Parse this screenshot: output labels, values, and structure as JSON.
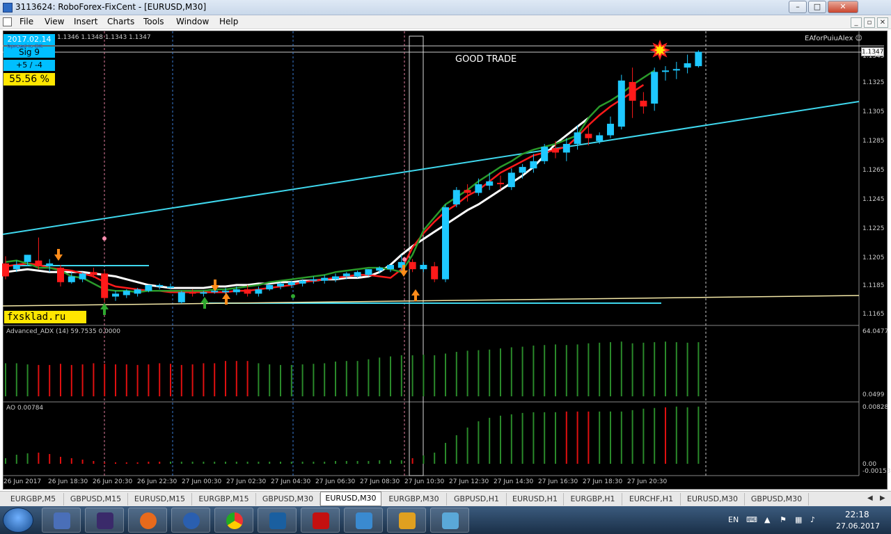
{
  "window": {
    "title": "3113624: RoboForex-FixCent - [EURUSD,M30]",
    "min": "–",
    "max": "□",
    "close": "✕"
  },
  "menu": [
    "File",
    "View",
    "Insert",
    "Charts",
    "Tools",
    "Window",
    "Help"
  ],
  "mdi_controls": [
    "_",
    "▫",
    "✕"
  ],
  "info_panel": {
    "date": "2017.02.14",
    "spread_note": "Spread is OK",
    "signal": "Sig  9",
    "plus_minus": "+5 / -4",
    "percent": "55.56 %"
  },
  "ohlc": "1.1346 1.1348 1.1343 1.1347",
  "ea_label": "EAforPuiuAlex ☺",
  "annotation": "GOOD TRADE",
  "brand": "fxsklad.ru",
  "price_axis": [
    "1.1345",
    "1.1325",
    "1.1305",
    "1.1285",
    "1.1265",
    "1.1245",
    "1.1225",
    "1.1205",
    "1.1185",
    "1.1165"
  ],
  "current_price": "1.1347",
  "adx": {
    "label": "Advanced_ADX (14) 59.7535 0.0000",
    "max": "64.0477",
    "min": "0.0499"
  },
  "ao": {
    "label": "AO 0.00784",
    "max": "0.00828",
    "zero": "0.00",
    "min": "-0.00153"
  },
  "time_axis": [
    "26 Jun 2017",
    "26 Jun 18:30",
    "26 Jun 20:30",
    "26 Jun 22:30",
    "27 Jun 00:30",
    "27 Jun 02:30",
    "27 Jun 04:30",
    "27 Jun 06:30",
    "27 Jun 08:30",
    "27 Jun 10:30",
    "27 Jun 12:30",
    "27 Jun 14:30",
    "27 Jun 16:30",
    "27 Jun 18:30",
    "27 Jun 20:30"
  ],
  "tabs": [
    "EURGBP,M5",
    "GBPUSD,M15",
    "EURUSD,M15",
    "EURGBP,M15",
    "GBPUSD,M30",
    "EURUSD,M30",
    "EURGBP,M30",
    "GBPUSD,H1",
    "EURUSD,H1",
    "EURGBP,H1",
    "EURCHF,H1",
    "EURUSD,M30",
    "GBPUSD,M30"
  ],
  "active_tab": "EURUSD,M30",
  "tray": {
    "lang": "EN",
    "time": "22:18",
    "date": "27.06.2017"
  },
  "colors": {
    "bull": "#1ec8ff",
    "bear": "#ff1a1a",
    "ma_fast": "#2a9a2a",
    "ma_mid": "#ff1a1a",
    "ma_slow": "#ffffff",
    "trend": "#3fd8ee",
    "support": "#f5e9a8"
  },
  "chart_data": {
    "type": "candlestick",
    "symbol": "EURUSD",
    "timeframe": "M30",
    "y_axis": {
      "min": 1.1165,
      "max": 1.1345
    },
    "candles": [
      [
        1.1199,
        1.1204,
        1.119,
        1.1188
      ],
      [
        1.1195,
        1.1201,
        1.1198,
        1.1193
      ],
      [
        1.12,
        1.1202,
        1.1205,
        1.1197
      ],
      [
        1.1201,
        1.1217,
        1.1197,
        1.1195
      ],
      [
        1.1197,
        1.1202,
        1.1199,
        1.1193
      ],
      [
        1.1196,
        1.1198,
        1.1186,
        1.1183
      ],
      [
        1.1186,
        1.1193,
        1.119,
        1.1185
      ],
      [
        1.1188,
        1.1193,
        1.1192,
        1.1186
      ],
      [
        1.1193,
        1.1196,
        1.1191,
        1.1189
      ],
      [
        1.1192,
        1.1194,
        1.1175,
        1.1172
      ],
      [
        1.1176,
        1.118,
        1.1178,
        1.1173
      ],
      [
        1.1177,
        1.1181,
        1.118,
        1.1175
      ],
      [
        1.1178,
        1.1182,
        1.1181,
        1.1176
      ],
      [
        1.118,
        1.1183,
        1.1184,
        1.1179
      ],
      [
        1.1183,
        1.1185,
        1.1184,
        1.1181
      ],
      [
        1.1183,
        1.1185,
        1.1183,
        1.1181
      ],
      [
        1.1172,
        1.118,
        1.1179,
        1.1171
      ],
      [
        1.1179,
        1.1181,
        1.1178,
        1.1176
      ],
      [
        1.1178,
        1.118,
        1.1179,
        1.1176
      ],
      [
        1.1179,
        1.1181,
        1.118,
        1.1178
      ],
      [
        1.1179,
        1.1182,
        1.118,
        1.1177
      ],
      [
        1.1179,
        1.1183,
        1.1181,
        1.1177
      ],
      [
        1.1181,
        1.1184,
        1.1178,
        1.1176
      ],
      [
        1.1178,
        1.1183,
        1.1181,
        1.1176
      ],
      [
        1.1181,
        1.1185,
        1.1184,
        1.118
      ],
      [
        1.1183,
        1.1186,
        1.1185,
        1.1181
      ],
      [
        1.1184,
        1.1187,
        1.1186,
        1.1182
      ],
      [
        1.1185,
        1.1188,
        1.1187,
        1.1183
      ],
      [
        1.1187,
        1.119,
        1.1188,
        1.1185
      ],
      [
        1.1187,
        1.1191,
        1.1189,
        1.1185
      ],
      [
        1.1188,
        1.1192,
        1.119,
        1.1186
      ],
      [
        1.119,
        1.1193,
        1.1192,
        1.1188
      ],
      [
        1.119,
        1.1194,
        1.1193,
        1.1189
      ],
      [
        1.1191,
        1.1195,
        1.1195,
        1.119
      ],
      [
        1.1194,
        1.1197,
        1.1196,
        1.1192
      ],
      [
        1.1195,
        1.1198,
        1.1198,
        1.1193
      ],
      [
        1.1196,
        1.1205,
        1.12,
        1.1194
      ],
      [
        1.12,
        1.1202,
        1.1195,
        1.1193
      ],
      [
        1.1195,
        1.12,
        1.1198,
        1.1193
      ],
      [
        1.1197,
        1.12,
        1.1188,
        1.1186
      ],
      [
        1.1188,
        1.124,
        1.1238,
        1.1186
      ],
      [
        1.124,
        1.1252,
        1.125,
        1.1238
      ],
      [
        1.125,
        1.1254,
        1.1248,
        1.1242
      ],
      [
        1.1248,
        1.1258,
        1.1254,
        1.1246
      ],
      [
        1.1253,
        1.1262,
        1.1256,
        1.125
      ],
      [
        1.1255,
        1.126,
        1.1254,
        1.125
      ],
      [
        1.1252,
        1.1265,
        1.1262,
        1.125
      ],
      [
        1.1262,
        1.1268,
        1.1266,
        1.1258
      ],
      [
        1.1265,
        1.1275,
        1.127,
        1.1262
      ],
      [
        1.127,
        1.1282,
        1.128,
        1.1268
      ],
      [
        1.1279,
        1.1284,
        1.1276,
        1.1272
      ],
      [
        1.1276,
        1.1286,
        1.1282,
        1.127
      ],
      [
        1.1282,
        1.1295,
        1.129,
        1.1278
      ],
      [
        1.1289,
        1.1295,
        1.1286,
        1.1281
      ],
      [
        1.1284,
        1.129,
        1.1288,
        1.1282
      ],
      [
        1.1288,
        1.1301,
        1.1296,
        1.1286
      ],
      [
        1.1294,
        1.133,
        1.1326,
        1.1292
      ],
      [
        1.1325,
        1.1335,
        1.1312,
        1.13
      ],
      [
        1.1312,
        1.1318,
        1.1308,
        1.1303
      ],
      [
        1.131,
        1.1335,
        1.1332,
        1.1305
      ],
      [
        1.1332,
        1.1336,
        1.1333,
        1.1326
      ],
      [
        1.1333,
        1.1339,
        1.1334,
        1.1327
      ],
      [
        1.1335,
        1.1344,
        1.1338,
        1.1331
      ],
      [
        1.1336,
        1.1347,
        1.1346,
        1.1335
      ]
    ],
    "ma_fast": [
      1.12,
      1.1201,
      1.1199,
      1.1196,
      1.1196,
      1.1194,
      1.119,
      1.1189,
      1.1185,
      1.1181,
      1.118,
      1.118,
      1.1179,
      1.118,
      1.118,
      1.118,
      1.118,
      1.118,
      1.118,
      1.1181,
      1.1181,
      1.1182,
      1.1183,
      1.1184,
      1.1186,
      1.1187,
      1.1188,
      1.1189,
      1.119,
      1.1191,
      1.1193,
      1.1194,
      1.1195,
      1.1196,
      1.1196,
      1.1195,
      1.1193,
      1.1205,
      1.1222,
      1.1231,
      1.124,
      1.1245,
      1.125,
      1.1256,
      1.1261,
      1.1266,
      1.127,
      1.1275,
      1.1278,
      1.128,
      1.1282,
      1.1285,
      1.1288,
      1.13,
      1.1308,
      1.1312,
      1.1317,
      1.1323,
      1.1328,
      1.1333
    ],
    "ma_mid": [
      1.1197,
      1.1198,
      1.1199,
      1.1198,
      1.1196,
      1.1195,
      1.1194,
      1.1192,
      1.119,
      1.1186,
      1.1183,
      1.1182,
      1.1181,
      1.118,
      1.118,
      1.1179,
      1.1179,
      1.1179,
      1.1179,
      1.1179,
      1.1179,
      1.118,
      1.118,
      1.1181,
      1.1182,
      1.1183,
      1.1184,
      1.1186,
      1.1187,
      1.1188,
      1.1189,
      1.119,
      1.1191,
      1.1191,
      1.119,
      1.1189,
      1.1195,
      1.121,
      1.122,
      1.1228,
      1.1235,
      1.124,
      1.1246,
      1.125,
      1.1256,
      1.1262,
      1.1266,
      1.127,
      1.1274,
      1.1276,
      1.1278,
      1.128,
      1.1287,
      1.1295,
      1.1302,
      1.1308,
      1.1313,
      1.1318,
      1.1323
    ],
    "ma_slow": [
      1.1193,
      1.1194,
      1.1195,
      1.1194,
      1.1193,
      1.1193,
      1.1193,
      1.1193,
      1.1192,
      1.1191,
      1.119,
      1.1188,
      1.1186,
      1.1184,
      1.1183,
      1.1182,
      1.1182,
      1.1182,
      1.1182,
      1.1183,
      1.1183,
      1.1184,
      1.1184,
      1.1185,
      1.1185,
      1.1186,
      1.1186,
      1.1187,
      1.1187,
      1.1188,
      1.1188,
      1.1189,
      1.1189,
      1.119,
      1.1193,
      1.1198,
      1.1205,
      1.1211,
      1.1216,
      1.1221,
      1.1226,
      1.1231,
      1.1236,
      1.124,
      1.1245,
      1.125,
      1.1255,
      1.126,
      1.1266,
      1.1274,
      1.1282,
      1.1288,
      1.1294,
      1.13
    ],
    "adx_values": [
      0.58,
      0.58,
      0.56,
      0.55,
      0.55,
      0.57,
      0.55,
      0.56,
      0.58,
      0.57,
      0.56,
      0.56,
      0.55,
      0.56,
      0.58,
      0.57,
      0.55,
      0.56,
      0.58,
      0.58,
      0.62,
      0.62,
      0.62,
      0.58,
      0.56,
      0.55,
      0.55,
      0.56,
      0.57,
      0.58,
      0.61,
      0.62,
      0.62,
      0.65,
      0.68,
      0.7,
      0.72,
      0.72,
      0.73,
      0.72,
      0.75,
      0.78,
      0.8,
      0.81,
      0.82,
      0.84,
      0.86,
      0.87,
      0.89,
      0.9,
      0.91,
      0.9,
      0.91,
      0.93,
      0.94,
      0.95,
      0.96,
      0.93,
      0.94,
      0.95,
      0.96,
      0.95,
      0.94,
      0.95
    ],
    "adx_colors": [
      "g",
      "g",
      "g",
      "r",
      "r",
      "r",
      "r",
      "r",
      "r",
      "r",
      "r",
      "r",
      "r",
      "r",
      "r",
      "r",
      "r",
      "r",
      "r",
      "r",
      "r",
      "r",
      "r",
      "g",
      "g",
      "g",
      "g",
      "g",
      "g",
      "g",
      "g",
      "g",
      "g",
      "g",
      "g",
      "g",
      "g",
      "g",
      "g",
      "g",
      "g",
      "g",
      "g",
      "g",
      "g",
      "g",
      "g",
      "g",
      "g",
      "g",
      "g",
      "g",
      "g",
      "g",
      "g",
      "g",
      "g",
      "g",
      "g",
      "g",
      "g",
      "g",
      "g",
      "g"
    ],
    "ao_values": [
      0.0008,
      0.0013,
      0.0015,
      0.0016,
      0.0014,
      0.001,
      0.0008,
      0.0006,
      0.0004,
      0.0002,
      0.0002,
      0.0002,
      0.0002,
      0.0003,
      0.0003,
      0.0003,
      0.0003,
      0.0003,
      0.0003,
      0.0003,
      0.0003,
      0.0003,
      0.0003,
      0.0003,
      0.0003,
      0.0003,
      0.0003,
      0.0003,
      0.0003,
      0.0003,
      0.0004,
      0.0004,
      0.0004,
      0.0004,
      0.0005,
      0.0005,
      0.0005,
      0.0008,
      0.0012,
      0.0016,
      0.003,
      0.0041,
      0.0052,
      0.0061,
      0.0066,
      0.0069,
      0.0071,
      0.0073,
      0.0074,
      0.0074,
      0.0074,
      0.0075,
      0.0075,
      0.0075,
      0.0075,
      0.0075,
      0.0075,
      0.0077,
      0.0079,
      0.008,
      0.0081,
      0.0082,
      0.0081,
      0.0082
    ],
    "ao_colors": [
      "g",
      "g",
      "g",
      "r",
      "r",
      "r",
      "r",
      "r",
      "r",
      "r",
      "r",
      "r",
      "r",
      "r",
      "r",
      "g",
      "g",
      "g",
      "g",
      "g",
      "g",
      "g",
      "g",
      "g",
      "g",
      "g",
      "g",
      "g",
      "g",
      "g",
      "g",
      "g",
      "g",
      "g",
      "g",
      "g",
      "g",
      "r",
      "g",
      "g",
      "g",
      "g",
      "g",
      "g",
      "g",
      "g",
      "g",
      "g",
      "g",
      "g",
      "g",
      "r",
      "r",
      "r",
      "g",
      "g",
      "g",
      "g",
      "g",
      "g",
      "r",
      "g",
      "g",
      "g"
    ]
  }
}
